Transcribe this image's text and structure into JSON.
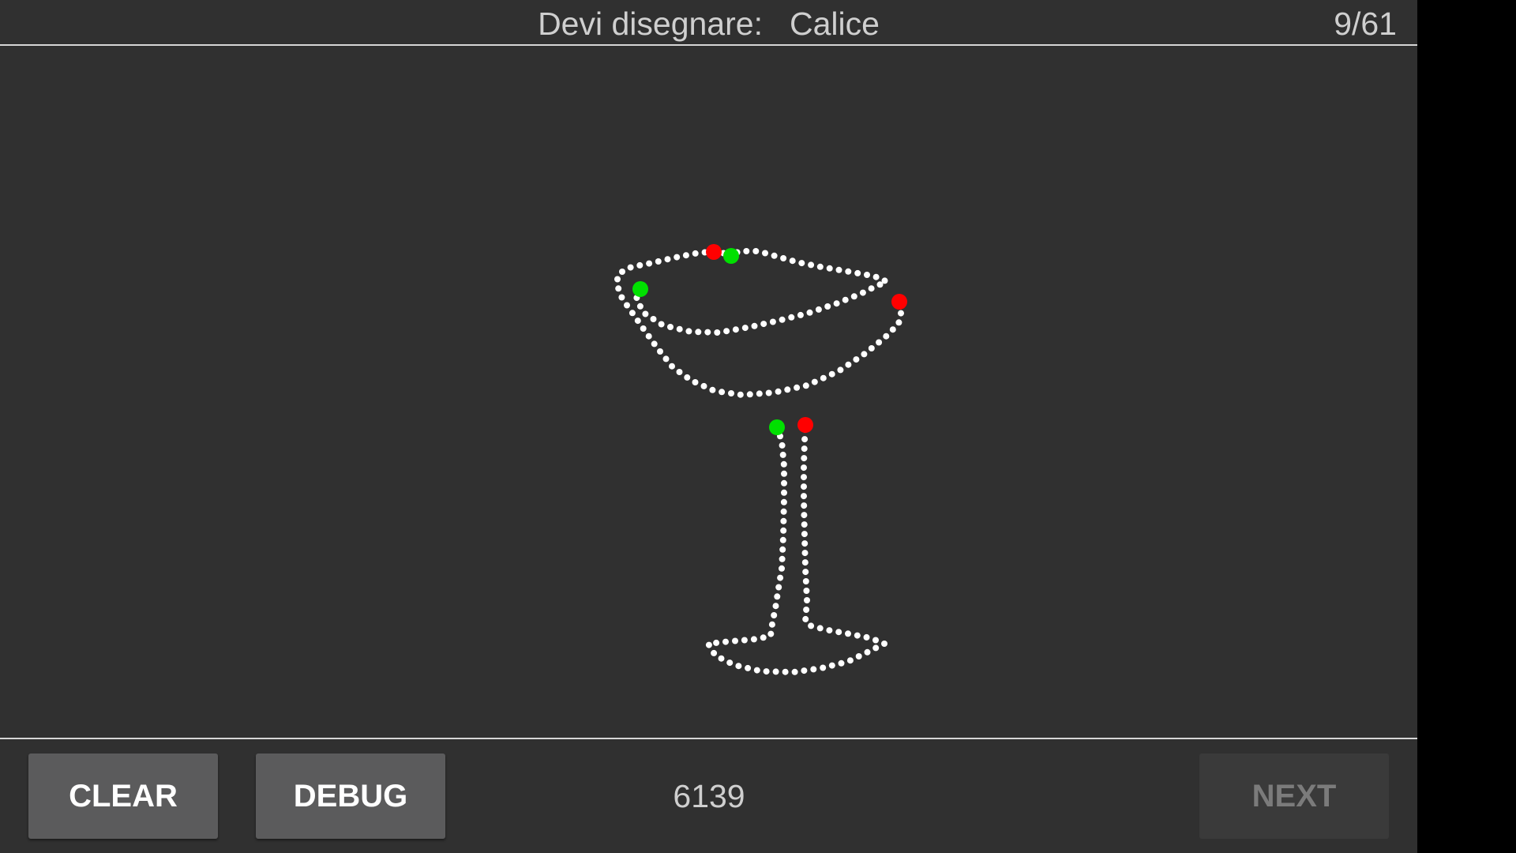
{
  "header": {
    "prompt_label": "Devi disegnare:",
    "target_word": "Calice",
    "progress": "9/61"
  },
  "footer": {
    "clear_label": "CLEAR",
    "debug_label": "DEBUG",
    "score": "6139",
    "next_label": "NEXT",
    "next_enabled": false
  },
  "drawing": {
    "subject": "wine-glass",
    "stroke_dot_color": "#ffffff",
    "stroke_start_color": "#00e000",
    "stroke_end_color": "#ff0000",
    "stroke_count": 3
  },
  "colors": {
    "background": "#303030",
    "divider": "#d6d6d6",
    "button": "#5b5b5c",
    "button_disabled": "#3a3a3a",
    "text": "#cfcfcf"
  }
}
